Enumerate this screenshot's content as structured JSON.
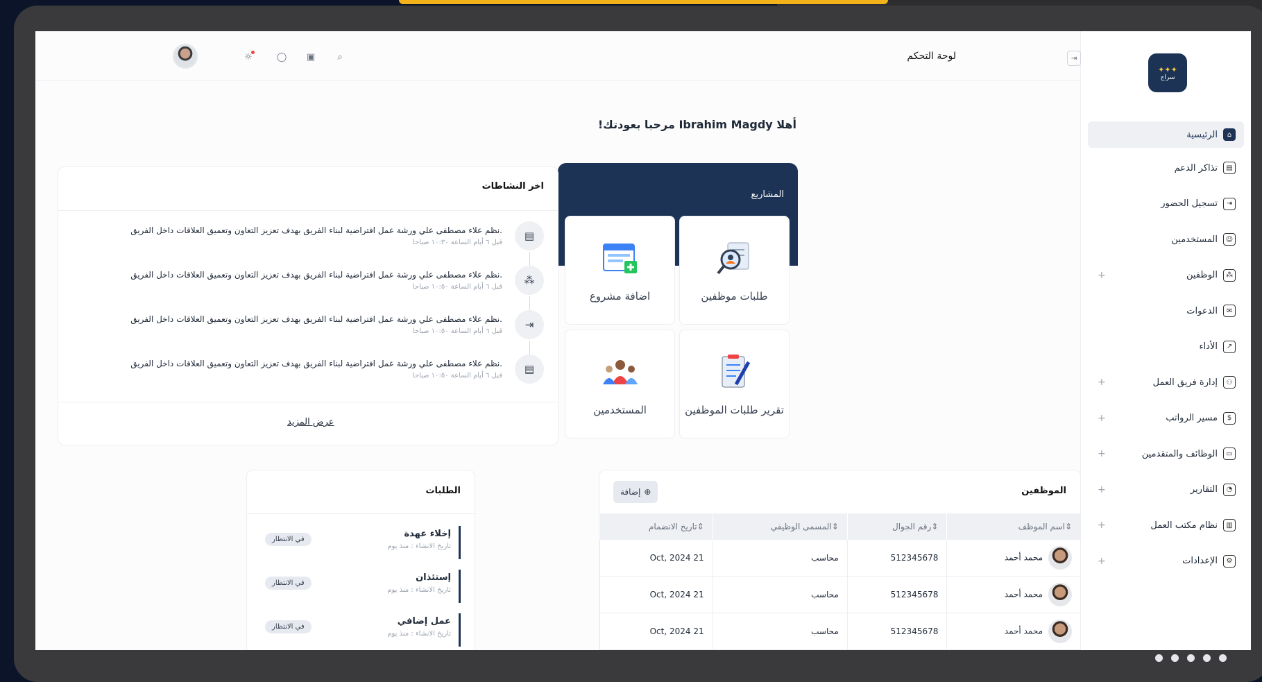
{
  "app": {
    "logo_text": "سراج",
    "page_title": "لوحة التحكم"
  },
  "colors": {
    "primary": "#1d3355",
    "accent": "#f3b21a",
    "background": "#fcfcfd"
  },
  "sidebar": {
    "items": [
      {
        "label": "الرئيسية",
        "icon": "home-icon",
        "active": true
      },
      {
        "label": "تذاكر الدعم",
        "icon": "ticket-icon"
      },
      {
        "label": "تسجيل الحضور",
        "icon": "login-icon"
      },
      {
        "label": "المستخدمين",
        "icon": "user-icon"
      },
      {
        "label": "الوظفين",
        "icon": "people-icon",
        "expandable": true
      },
      {
        "label": "الدعوات",
        "icon": "mail-icon"
      },
      {
        "label": "الأداء",
        "icon": "chart-icon"
      },
      {
        "label": "إدارة فريق العمل",
        "icon": "team-icon",
        "expandable": true
      },
      {
        "label": "مسير الرواتب",
        "icon": "dollar-icon",
        "expandable": true
      },
      {
        "label": "الوظائف والمتقدمين",
        "icon": "briefcase-icon",
        "expandable": true
      },
      {
        "label": "التقارير",
        "icon": "report-icon",
        "expandable": true
      },
      {
        "label": "نظام مكتب العمل",
        "icon": "book-icon",
        "expandable": true
      },
      {
        "label": "الإعدادات",
        "icon": "settings-icon",
        "expandable": true
      }
    ]
  },
  "welcome": "أهلا Ibrahim Magdy مرحبا بعودتك!",
  "projects": {
    "title": "المشاريع",
    "tiles": [
      {
        "label": "طلبات موظفين",
        "icon": "employee-search-icon"
      },
      {
        "label": "اضافة مشروع",
        "icon": "calendar-add-icon"
      },
      {
        "label": "تقرير طلبات الموظفين",
        "icon": "report-edit-icon"
      },
      {
        "label": "المستخدمين",
        "icon": "users-group-icon"
      }
    ]
  },
  "activities": {
    "title": "اخر النشاطات",
    "items": [
      {
        "text": ".نظم علاء مصطفى علي ورشة عمل افتراضية لبناء الفريق بهدف تعزيز التعاون وتعميق العلاقات داخل الفريق",
        "time": "قبل ٦ أيام الساعة ١٠:٣٠ صباحا",
        "icon": "ticket-icon"
      },
      {
        "text": ".نظم علاء مصطفى علي ورشة عمل افتراضية لبناء الفريق بهدف تعزيز التعاون وتعميق العلاقات داخل الفريق",
        "time": "قبل ٦ أيام الساعة ١٠:٥٠ صباحا",
        "icon": "people-icon"
      },
      {
        "text": ".نظم علاء مصطفى علي ورشة عمل افتراضية لبناء الفريق بهدف تعزيز التعاون وتعميق العلاقات داخل الفريق",
        "time": "قبل ٦ أيام الساعة ١٠:٥٠ صباحا",
        "icon": "login-icon"
      },
      {
        "text": ".نظم علاء مصطفى علي ورشة عمل افتراضية لبناء الفريق بهدف تعزيز التعاون وتعميق العلاقات داخل الفريق",
        "time": "قبل ٦ أيام الساعة ١٠:٥٠ صباحا",
        "icon": "ticket-icon"
      }
    ],
    "more": "عرض المزيد"
  },
  "employees": {
    "title": "الموظفين",
    "add_label": "إضافة",
    "columns": [
      "اسم الموظف",
      "رقم الجوال",
      "المسمى الوظيفي",
      "تاريخ الانضمام"
    ],
    "rows": [
      {
        "name": "محمد أحمد",
        "phone": "512345678",
        "job": "محاسب",
        "date": "21 Oct, 2024"
      },
      {
        "name": "محمد أحمد",
        "phone": "512345678",
        "job": "محاسب",
        "date": "21 Oct, 2024"
      },
      {
        "name": "محمد أحمد",
        "phone": "512345678",
        "job": "محاسب",
        "date": "21 Oct, 2024"
      }
    ]
  },
  "requests": {
    "title": "الطلبات",
    "items": [
      {
        "name": "إخلاء عهدة",
        "date": "تاريخ الانشاء : منذ يوم",
        "status": "في الانتظار"
      },
      {
        "name": "إستئذان",
        "date": "تاريخ الانشاء : منذ يوم",
        "status": "في الانتظار"
      },
      {
        "name": "عمل إضافي",
        "date": "تاريخ الانشاء : منذ يوم",
        "status": "في الانتظار"
      }
    ]
  }
}
